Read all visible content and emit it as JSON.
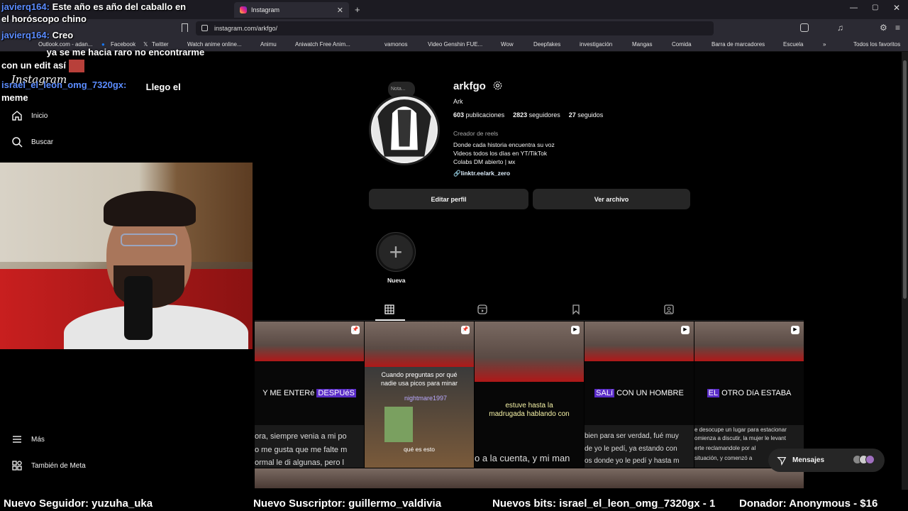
{
  "browser": {
    "tabs": [
      {
        "label": "javierq164:"
      },
      {
        "label": "Este año es año del caballo en"
      },
      {
        "label": "Instagram"
      }
    ],
    "url": "instagram.com/arkfgo/",
    "bookmarks": [
      "Outlook.com - adan...",
      "Facebook",
      "Twitter",
      "Watch anime online...",
      "Animu",
      "Aniwatch Free Anim...",
      "vamonos",
      "Video Genshin FUE...",
      "Wow",
      "Deepfakes",
      "investigación",
      "Mangas",
      "Comida",
      "Barra de marcadores",
      "Escuela",
      "Todos los favoritos"
    ]
  },
  "sidebar": {
    "logo": "Instagram",
    "items": [
      {
        "label": "Inicio",
        "icon": "home-icon"
      },
      {
        "label": "Buscar",
        "icon": "search-icon"
      },
      {
        "label": "Más",
        "icon": "menu-icon"
      },
      {
        "label": "También de Meta",
        "icon": "meta-icon"
      }
    ]
  },
  "profile": {
    "username": "arkfgo",
    "note_placeholder": "Nota...",
    "name": "Ark",
    "stats": {
      "posts_num": "603",
      "posts_label": "publicaciones",
      "followers_num": "2823",
      "followers_label": "seguidores",
      "following_num": "27",
      "following_label": "seguidos"
    },
    "category": "Creador de reels",
    "bio": [
      "Donde cada historia encuentra su voz",
      "Videos todos los días en YT/TikTok",
      "Colabs DM abierto | мх"
    ],
    "link": "linktr.ee/ark_zero",
    "edit_button": "Editar perfil",
    "archive_button": "Ver archivo",
    "highlight_new": "Nueva"
  },
  "posts": [
    {
      "caption": "Y ME ENTERé",
      "caption_hl": "DESPUéS",
      "sub": "ora, siempre venia a mi po",
      "sub2": "o me gusta que me falte m",
      "sub3": "ormal le di algunas, pero l",
      "pinned": true
    },
    {
      "caption": "Cuando preguntas por qué",
      "caption2": "nadie usa picos para minar",
      "game_text": "qué es esto",
      "player": "nightmare1997",
      "pinned": true
    },
    {
      "caption": "estuve hasta la",
      "caption2": "madrugada hablando con",
      "sub": "o a la cuenta, y mi man",
      "reel": true
    },
    {
      "caption_hl": "SALí",
      "caption": "CON UN HOMBRE",
      "sub": "bien para ser verdad, fué muy",
      "sub2": "de yo le pedí, ya estando con",
      "sub3": "os donde yo le pedí y hasta m",
      "reel": true
    },
    {
      "caption_hl": "EL",
      "caption": "OTRO DíA ESTABA",
      "sub": "e desocupe un lugar para estacionar",
      "sub2": "omienza a discutir, la mujer le levant",
      "sub3": "erte reclamandole por al",
      "sub4": "situación, y comenzó a",
      "reel": true
    }
  ],
  "messages_button": "Mensajes",
  "stream": {
    "chat": [
      {
        "user": "javierq164:",
        "text": "Este año es año del caballo en"
      },
      {
        "user": "",
        "text": "el horóscopo chino"
      },
      {
        "user": "javierq164:",
        "text": "Creo"
      },
      {
        "user": "",
        "text": "ya se me hacia raro no encontrarme"
      },
      {
        "user": "",
        "text": "con un edit así"
      },
      {
        "user": "israel_el_leon_omg_7320gx:",
        "text": "Llego el"
      },
      {
        "user": "",
        "text": "meme"
      }
    ],
    "ticker": [
      "Nuevo Seguidor: yuzuha_uka",
      "Nuevo Suscriptor: guillermo_valdivia",
      "Nuevos bits: israel_el_leon_omg_7320gx - 1",
      "Donador: Anonymous - $16"
    ]
  }
}
